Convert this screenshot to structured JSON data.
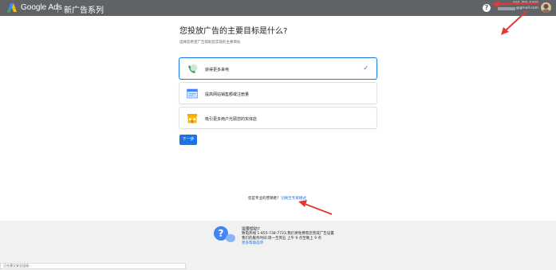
{
  "topbar": {
    "brand": "Google Ads",
    "subtitle": "新广告系列",
    "help_icon": "?",
    "account_phone": "555-755-6499",
    "account_email_suffix": "@gmail.com"
  },
  "main": {
    "question": "您投放广告的主要目标是什么?",
    "description": "选择您希望广告帮助您实现的主要目标",
    "goals": [
      {
        "label": "获得更多来电",
        "icon": "phone-icon",
        "selected": true
      },
      {
        "label": "提高网站销售额或注册量",
        "icon": "website-icon",
        "selected": false
      },
      {
        "label": "吸引更多用户光顾您的实体店",
        "icon": "store-icon",
        "selected": false
      }
    ],
    "check_icon": "✓",
    "next_button": "下一步",
    "expert_prompt": "您是专业的营销者?",
    "expert_link": "切换至专家模式"
  },
  "footer": {
    "help_icon": "?",
    "title": "需要帮助?",
    "line1": "致电热线 1-855-738-7723,我们将免费帮您完成广告设置",
    "line2": "我们的服务时间:周一至周五 上午 9 点至晚上 9 点",
    "link": "更多帮助选项"
  },
  "status_bar": "正在建立安全连接...",
  "colors": {
    "topbar": "#5f6368",
    "accent": "#1a73e8",
    "annotation": "#e53935"
  }
}
